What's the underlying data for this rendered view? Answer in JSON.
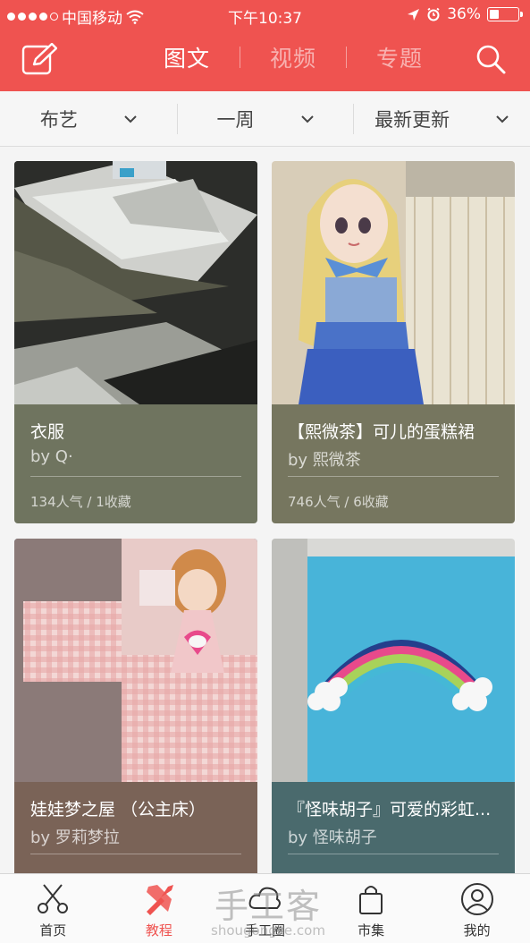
{
  "status_bar": {
    "carrier": "中国移动",
    "time": "下午10:37",
    "battery": "36%"
  },
  "header": {
    "tabs": [
      {
        "label": "图文",
        "active": true
      },
      {
        "label": "视频",
        "active": false
      },
      {
        "label": "专题",
        "active": false
      }
    ],
    "accent_color": "#ef5350"
  },
  "filters": [
    {
      "label": "布艺"
    },
    {
      "label": "一周"
    },
    {
      "label": "最新更新"
    }
  ],
  "cards": [
    {
      "title": "衣服",
      "author": "by Q·",
      "stats": "134人气 / 1收藏",
      "info_color": "#6f745f"
    },
    {
      "title": "【熙微茶】可儿的蛋糕裙",
      "author": "by 熙微茶",
      "stats": "746人气 / 6收藏",
      "info_color": "#76765f"
    },
    {
      "title": "娃娃梦之屋 （公主床）",
      "author": "by 罗莉梦拉",
      "stats": "",
      "info_color": "#7a6357"
    },
    {
      "title": "『怪味胡子』可爱的彩虹...",
      "author": "by 怪味胡子",
      "stats": "",
      "info_color": "#4a6a6d"
    }
  ],
  "tabbar": {
    "items": [
      {
        "label": "首页",
        "icon": "scissors-icon",
        "active": false
      },
      {
        "label": "教程",
        "icon": "tools-icon",
        "active": true
      },
      {
        "label": "手工圈",
        "icon": "cloud-icon",
        "active": false
      },
      {
        "label": "市集",
        "icon": "shopping-bag-icon",
        "active": false
      },
      {
        "label": "我的",
        "icon": "user-icon",
        "active": false
      }
    ],
    "watermark_main": "手工客",
    "watermark_sub": "shougongke.com"
  }
}
